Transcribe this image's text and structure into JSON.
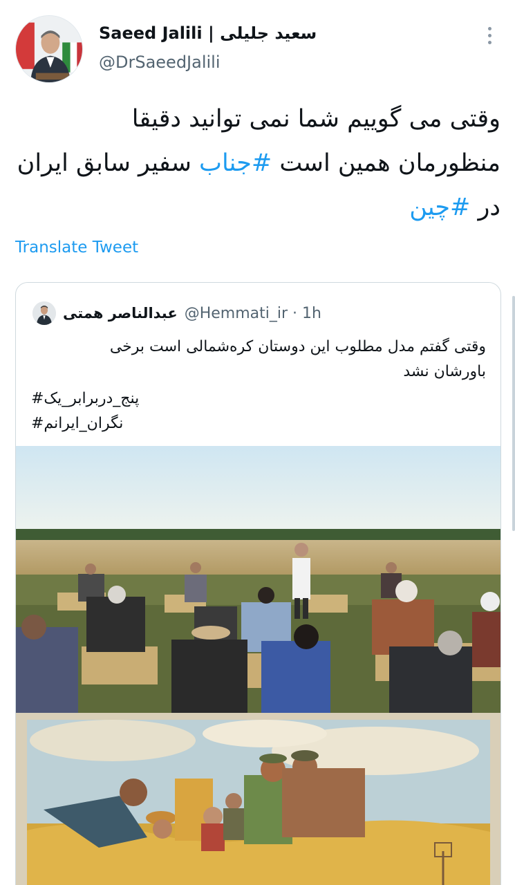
{
  "tweet": {
    "display_name": "Saeed Jalili | سعید جلیلی",
    "handle": "@DrSaeedJalili",
    "text_line1": "وقتی می گوییم شما نمی توانید دقیقا",
    "text_line2_a": "منظورمان همین است ",
    "text_line2_hashtag": "#جناب",
    "text_line2_b": " سفیر سابق ایران",
    "text_line3_a": "در ",
    "text_line3_hashtag": "#چین",
    "translate_label": "Translate Tweet"
  },
  "quoted_tweet": {
    "name": "عبدالناصر همتی",
    "handle_time": "@Hemmati_ir · 1h",
    "text_line1": "وقتی گفتم مدل مطلوب این دوستان کره‌شمالی است برخی",
    "text_line2": "باورشان نشد",
    "hashtag1": "پنج_دربرابر_یک#",
    "hashtag2": "نگران_ایرانم#"
  },
  "icons": {
    "more": "more-vertical-icon"
  },
  "colors": {
    "link": "#1d9bf0",
    "secondary_text": "#536471",
    "border": "#cfd9de"
  }
}
